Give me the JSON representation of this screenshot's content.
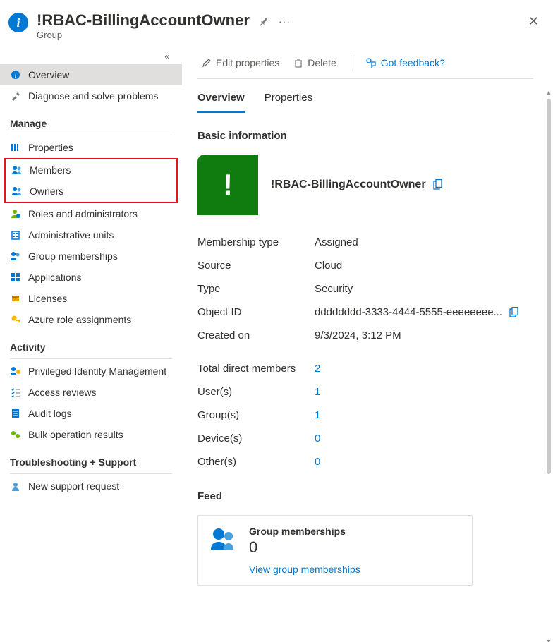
{
  "header": {
    "title": "!RBAC-BillingAccountOwner",
    "subtitle": "Group"
  },
  "toolbar": {
    "edit": "Edit properties",
    "delete": "Delete",
    "feedback": "Got feedback?"
  },
  "tabs": {
    "overview": "Overview",
    "properties": "Properties"
  },
  "sidebar": {
    "overview": "Overview",
    "diagnose": "Diagnose and solve problems",
    "manage_header": "Manage",
    "properties": "Properties",
    "members": "Members",
    "owners": "Owners",
    "roles": "Roles and administrators",
    "admin_units": "Administrative units",
    "group_memberships": "Group memberships",
    "applications": "Applications",
    "licenses": "Licenses",
    "azure_role": "Azure role assignments",
    "activity_header": "Activity",
    "pim": "Privileged Identity Management",
    "access_reviews": "Access reviews",
    "audit_logs": "Audit logs",
    "bulk": "Bulk operation results",
    "troubleshoot_header": "Troubleshooting + Support",
    "support": "New support request"
  },
  "basic": {
    "section": "Basic information",
    "group_name": "!RBAC-BillingAccountOwner",
    "membership_type_k": "Membership type",
    "membership_type_v": "Assigned",
    "source_k": "Source",
    "source_v": "Cloud",
    "type_k": "Type",
    "type_v": "Security",
    "object_id_k": "Object ID",
    "object_id_v": "dddddddd-3333-4444-5555-eeeeeeee...",
    "created_k": "Created on",
    "created_v": "9/3/2024, 3:12 PM"
  },
  "counts": {
    "tdm_k": "Total direct members",
    "tdm_v": "2",
    "users_k": "User(s)",
    "users_v": "1",
    "groups_k": "Group(s)",
    "groups_v": "1",
    "devices_k": "Device(s)",
    "devices_v": "0",
    "others_k": "Other(s)",
    "others_v": "0"
  },
  "feed": {
    "header": "Feed",
    "card_title": "Group memberships",
    "card_value": "0",
    "card_link": "View group memberships"
  }
}
